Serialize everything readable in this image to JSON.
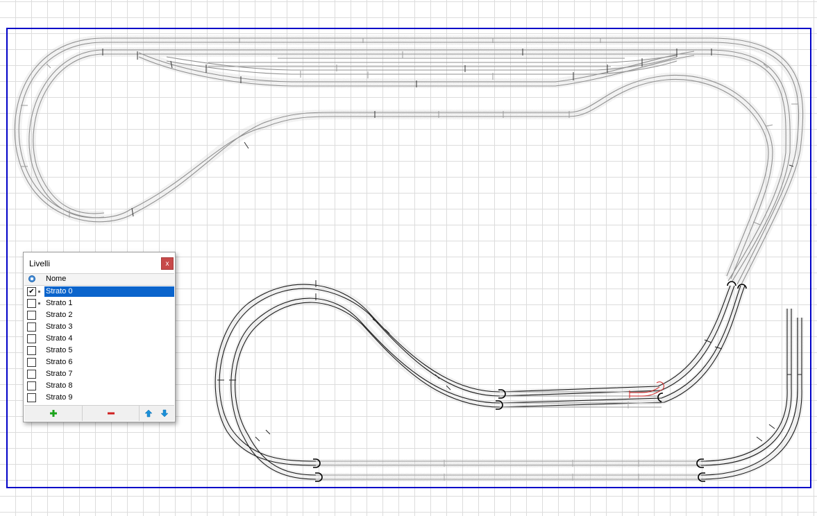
{
  "panel": {
    "title": "Livelli",
    "close_label": "x",
    "column_header": "Nome",
    "layers": [
      {
        "name": "Strato 0",
        "visible": true,
        "selected": true,
        "has_content": true
      },
      {
        "name": "Strato 1",
        "visible": false,
        "selected": false,
        "has_content": true
      },
      {
        "name": "Strato 2",
        "visible": false,
        "selected": false,
        "has_content": false
      },
      {
        "name": "Strato 3",
        "visible": false,
        "selected": false,
        "has_content": false
      },
      {
        "name": "Strato 4",
        "visible": false,
        "selected": false,
        "has_content": false
      },
      {
        "name": "Strato 5",
        "visible": false,
        "selected": false,
        "has_content": false
      },
      {
        "name": "Strato 6",
        "visible": false,
        "selected": false,
        "has_content": false
      },
      {
        "name": "Strato 7",
        "visible": false,
        "selected": false,
        "has_content": false
      },
      {
        "name": "Strato 8",
        "visible": false,
        "selected": false,
        "has_content": false
      },
      {
        "name": "Strato 9",
        "visible": false,
        "selected": false,
        "has_content": false
      }
    ],
    "toolbar_icons": [
      "add-icon",
      "remove-icon",
      "arrow-up-icon",
      "arrow-down-icon"
    ]
  },
  "colors": {
    "board_border": "#0000c8",
    "grid": "#dcdcdc",
    "track_upper": "#9a9a9a",
    "track_lower": "#1a1a1a",
    "selected_track": "#d02020",
    "selection": "#0a64cc",
    "add_icon": "#1aa31a",
    "remove_icon": "#d02020",
    "arrow_icon": "#1a8fd8"
  }
}
